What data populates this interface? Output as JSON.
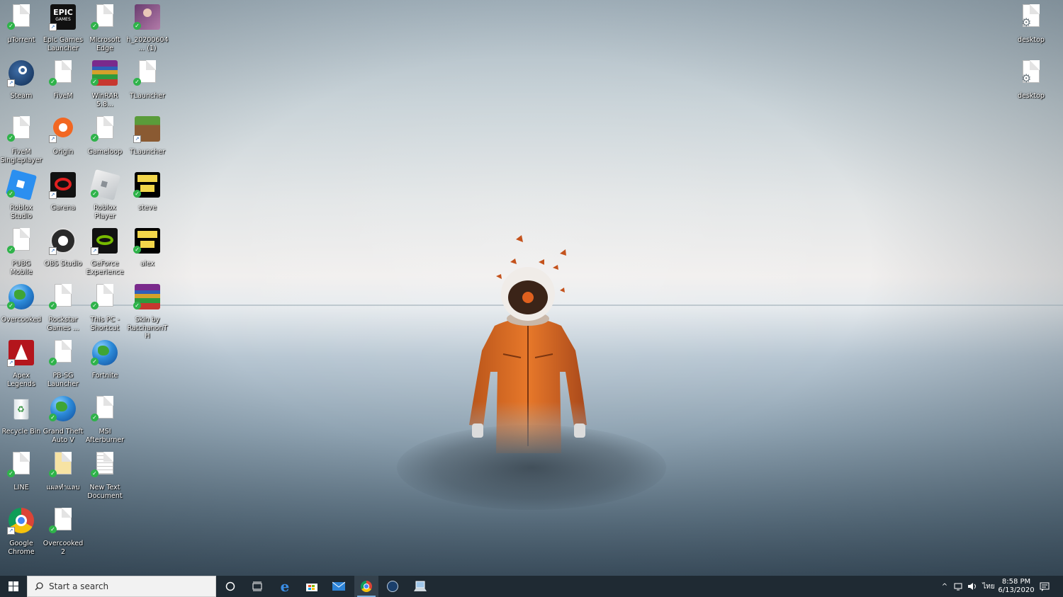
{
  "desktop": {
    "icons": [
      {
        "label": "µTorrent",
        "icon": "blank-file-icon"
      },
      {
        "label": "Epic Games Launcher",
        "icon": "epic-games-icon"
      },
      {
        "label": "Microsoft Edge",
        "icon": "blank-file-icon"
      },
      {
        "label": "h_20200604... (1)",
        "icon": "image-file-icon"
      },
      {
        "label": "Steam",
        "icon": "steam-icon"
      },
      {
        "label": "FiveM",
        "icon": "blank-file-icon"
      },
      {
        "label": "WinRAR 5.8...",
        "icon": "winrar-icon"
      },
      {
        "label": "TLauncher",
        "icon": "blank-file-icon"
      },
      {
        "label": "FiveM Singleplayer",
        "icon": "blank-file-icon"
      },
      {
        "label": "Origin",
        "icon": "origin-icon"
      },
      {
        "label": "Gameloop",
        "icon": "blank-file-icon"
      },
      {
        "label": "TLauncher",
        "icon": "minecraft-block-icon"
      },
      {
        "label": "Roblox Studio",
        "icon": "roblox-studio-icon"
      },
      {
        "label": "Garena",
        "icon": "garena-icon"
      },
      {
        "label": "Roblox Player",
        "icon": "roblox-player-icon"
      },
      {
        "label": "steve",
        "icon": "skin-image-icon"
      },
      {
        "label": "PUBG Mobile",
        "icon": "blank-file-icon"
      },
      {
        "label": "OBS Studio",
        "icon": "obs-icon"
      },
      {
        "label": "GeForce Experience",
        "icon": "nvidia-icon"
      },
      {
        "label": "alex",
        "icon": "skin-image-icon"
      },
      {
        "label": "Overcooked",
        "icon": "globe-icon"
      },
      {
        "label": "Rockstar Games ...",
        "icon": "blank-file-icon"
      },
      {
        "label": "This PC - Shortcut",
        "icon": "blank-file-icon"
      },
      {
        "label": "Skin by RatchanonTH",
        "icon": "winrar-icon"
      },
      {
        "label": "Apex Legends",
        "icon": "apex-icon"
      },
      {
        "label": "PB-SG Launcher",
        "icon": "blank-file-icon"
      },
      {
        "label": "Fortnite",
        "icon": "globe-icon"
      },
      {
        "label": "Recycle Bin",
        "icon": "recycle-bin-icon"
      },
      {
        "label": "Grand Theft Auto V",
        "icon": "globe-icon"
      },
      {
        "label": "MSI Afterburner",
        "icon": "blank-file-icon"
      },
      {
        "label": "LINE",
        "icon": "blank-file-icon"
      },
      {
        "label": "แผลทำแลบ",
        "icon": "folder-file-icon"
      },
      {
        "label": "New Text Document",
        "icon": "text-document-icon"
      },
      {
        "label": "Google Chrome",
        "icon": "chrome-icon"
      },
      {
        "label": "Overcooked 2",
        "icon": "blank-file-icon"
      },
      {
        "label": "desktop",
        "icon": "settings-file-icon"
      },
      {
        "label": "desktop",
        "icon": "settings-file-icon"
      }
    ]
  },
  "taskbar": {
    "start_icon": "windows-logo-icon",
    "search_placeholder": "Start a search",
    "pinned": [
      "cortana-icon",
      "task-view-icon",
      "edge-icon",
      "store-icon",
      "mail-icon",
      "chrome-icon",
      "steam-icon",
      "tlauncher-icon"
    ],
    "tray": {
      "chevron": "^",
      "language": "ไทย",
      "time": "8:58 PM",
      "date": "6/13/2020"
    }
  }
}
